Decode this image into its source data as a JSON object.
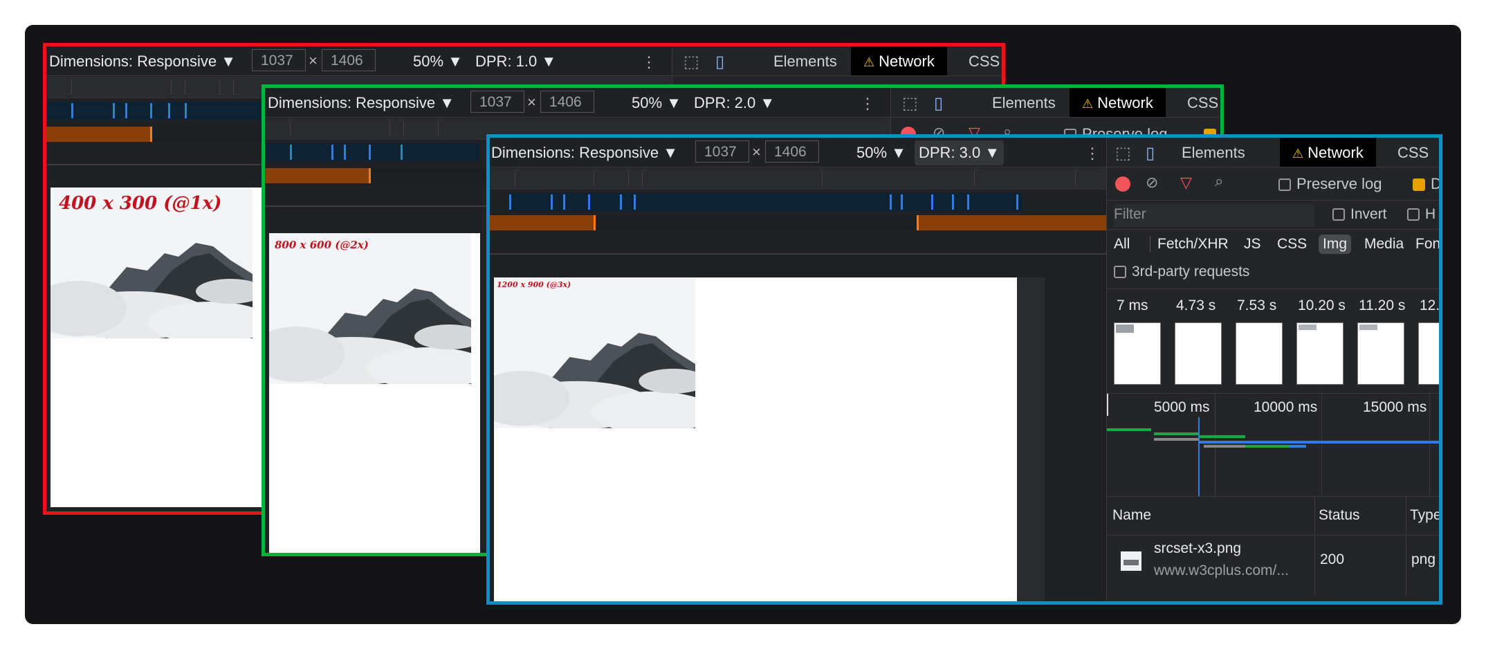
{
  "toolbar": {
    "dimensions_label": "Dimensions: Responsive",
    "dropdown_arrow": "▼",
    "width_value": "1037",
    "height_value": "1406",
    "times": "×",
    "zoom": "50%",
    "more": "⋮"
  },
  "frames": [
    {
      "dpr": "DPR: 1.0",
      "caption": "400 x 300 (@1x)",
      "border_color": "#e6141b"
    },
    {
      "dpr": "DPR: 2.0",
      "caption": "800 x 600 (@2x)",
      "border_color": "#08b33c"
    },
    {
      "dpr": "DPR: 3.0",
      "caption": "1200 x 900 (@3x)",
      "border_color": "#118ec2"
    }
  ],
  "devtools": {
    "tabs": [
      "Elements",
      "Network",
      "CSS"
    ],
    "active_tab": "Network",
    "warning_icon": "⚠",
    "preserve_log": "Preserve log",
    "filter_placeholder": "Filter",
    "invert": "Invert",
    "hide_partial": "H",
    "disable_partial": "D",
    "type_filters": [
      "All",
      "Fetch/XHR",
      "JS",
      "CSS",
      "Img",
      "Media",
      "Font"
    ],
    "active_type": "Img",
    "third_party": "3rd-party requests",
    "filmstrip_times": [
      "7 ms",
      "4.73 s",
      "7.53 s",
      "10.20 s",
      "11.20 s",
      "12."
    ],
    "timeline_labels": [
      "5000 ms",
      "10000 ms",
      "15000 ms"
    ],
    "columns": [
      "Name",
      "Status",
      "Type"
    ],
    "rows": [
      {
        "name": "srcset-x3.png",
        "url": "www.w3cplus.com/...",
        "status": "200",
        "type": "png"
      }
    ]
  }
}
